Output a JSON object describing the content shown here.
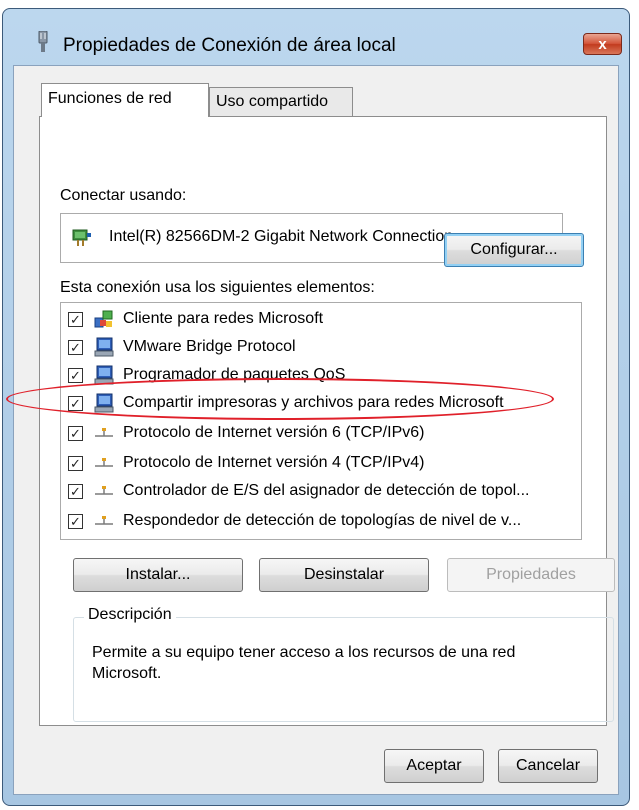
{
  "window": {
    "title": "Propiedades de Conexión de área local",
    "close_label": "x"
  },
  "tabs": [
    {
      "label": "Funciones de red",
      "selected": true
    },
    {
      "label": "Uso compartido",
      "selected": false
    }
  ],
  "connect": {
    "label": "Conectar usando:",
    "adapter": "Intel(R) 82566DM-2 Gigabit Network Connection",
    "adapter_icon": "network-adapter-icon",
    "configure_label": "Configurar..."
  },
  "items": {
    "label": "Esta conexión usa los siguientes elementos:",
    "list": [
      {
        "label": "Cliente para redes Microsoft",
        "checked": true,
        "icon": "network-client-icon"
      },
      {
        "label": "VMware Bridge Protocol",
        "checked": true,
        "icon": "network-service-icon"
      },
      {
        "label": "Programador de paquetes QoS",
        "checked": true,
        "icon": "network-service-icon"
      },
      {
        "label": "Compartir impresoras y archivos para redes Microsoft",
        "checked": true,
        "icon": "network-service-icon"
      },
      {
        "label": "Protocolo de Internet versión 6 (TCP/IPv6)",
        "checked": true,
        "icon": "protocol-icon",
        "highlighted": true
      },
      {
        "label": "Protocolo de Internet versión 4 (TCP/IPv4)",
        "checked": true,
        "icon": "protocol-icon"
      },
      {
        "label": "Controlador de E/S del asignador de detección de topol...",
        "checked": true,
        "icon": "protocol-icon"
      },
      {
        "label": "Respondedor de detección de topologías de nivel de v...",
        "checked": true,
        "icon": "protocol-icon"
      }
    ]
  },
  "actions": {
    "install_label": "Instalar...",
    "uninstall_label": "Desinstalar",
    "properties_label": "Propiedades",
    "properties_enabled": false
  },
  "description": {
    "legend": "Descripción",
    "text": "Permite a su equipo tener acceso a los recursos de una red Microsoft."
  },
  "footer": {
    "ok_label": "Aceptar",
    "cancel_label": "Cancelar"
  },
  "colors": {
    "highlight_ellipse": "#e0202a",
    "focus_button": "#3c7fb1"
  }
}
